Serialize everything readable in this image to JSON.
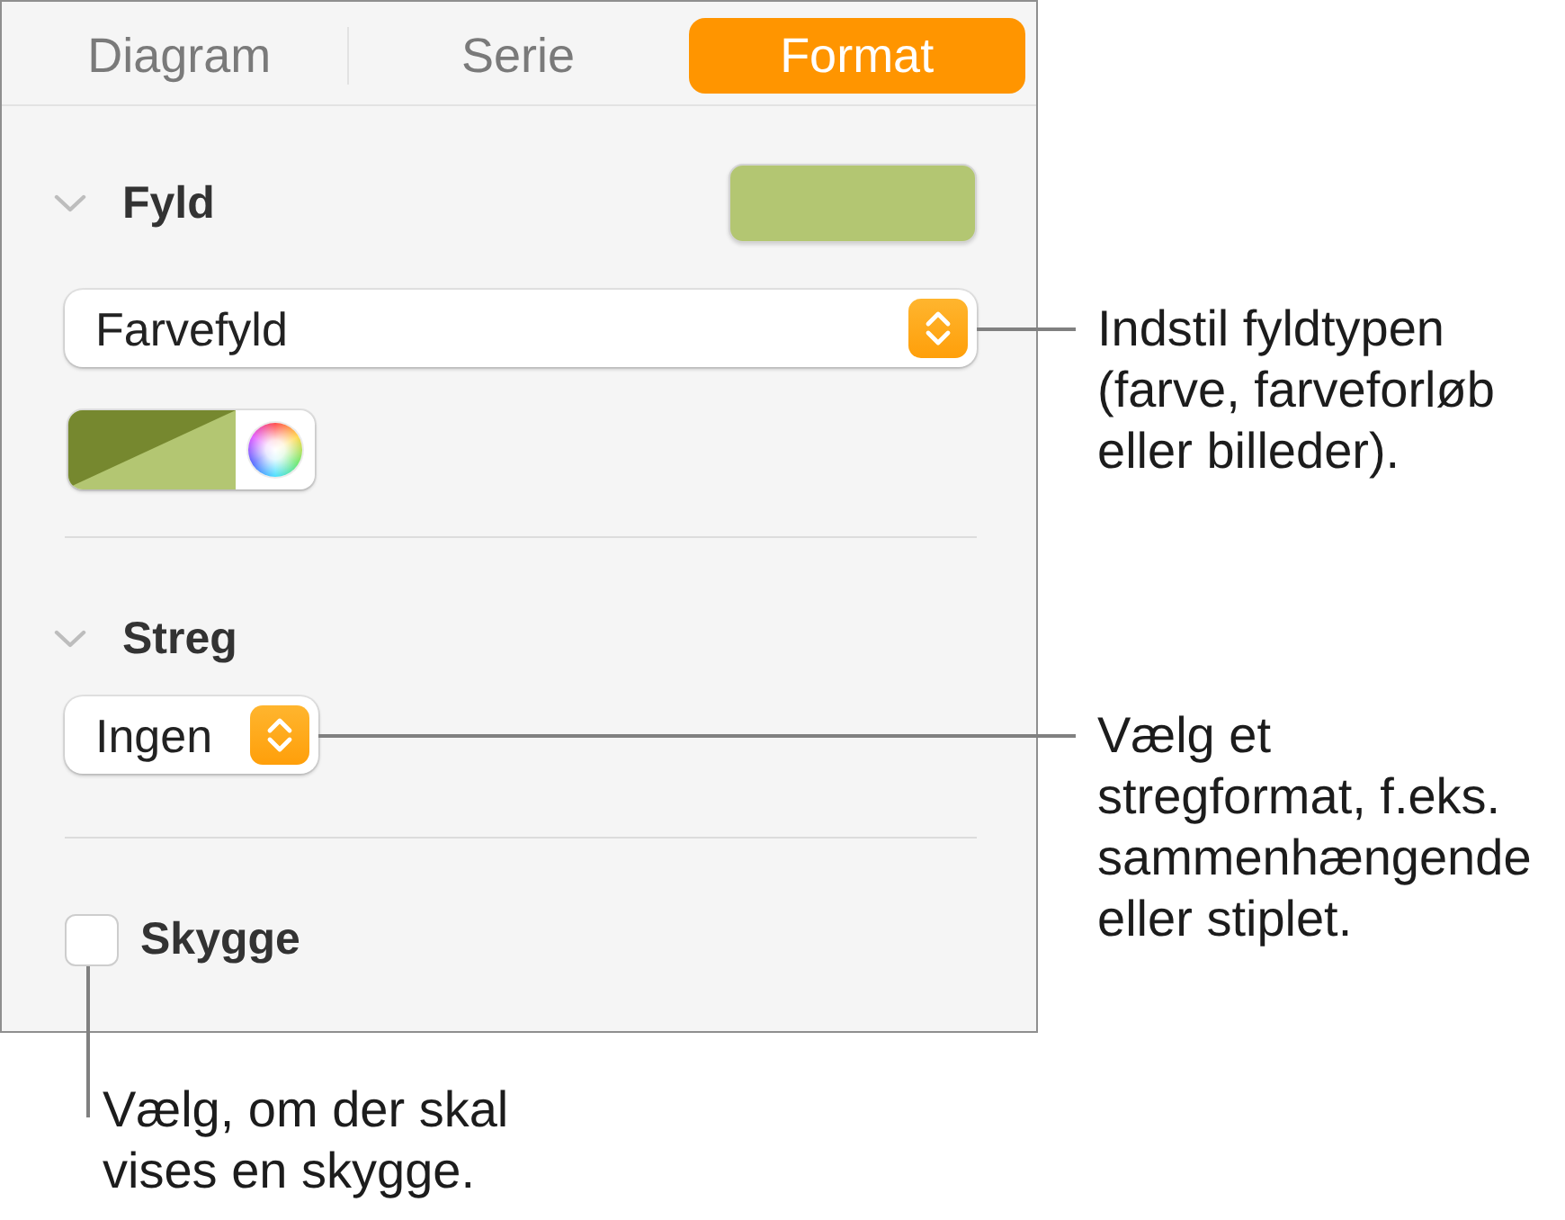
{
  "tabs": [
    {
      "label": "Diagram",
      "selected": false
    },
    {
      "label": "Serie",
      "selected": false
    },
    {
      "label": "Format",
      "selected": true
    }
  ],
  "fill": {
    "title": "Fyld",
    "expanded": true,
    "fill_type": "Farvefyld",
    "fill_type_callout": "Indstil fyldtypen\n(farve, farveforløb\neller billeder)."
  },
  "stroke": {
    "title": "Streg",
    "expanded": true,
    "style": "Ingen",
    "style_callout": "Vælg et\nstregformat, f.eks.\nsammenhængende\neller stiplet."
  },
  "shadow": {
    "label": "Skygge",
    "checked": false,
    "callout": "Vælg, om der skal\nvises en skygge."
  }
}
